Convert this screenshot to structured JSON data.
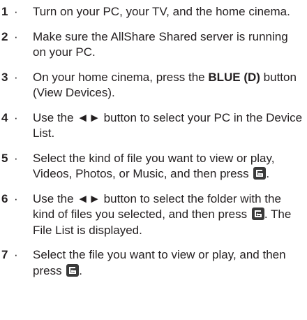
{
  "steps": [
    {
      "number": "1",
      "separator": "·",
      "text": "Turn on your PC, your TV, and the home cinema."
    },
    {
      "number": "2",
      "separator": "·",
      "text": "Make sure the AllShare Shared server is running on your PC."
    },
    {
      "number": "3",
      "separator": "·",
      "text_before": "On your home cinema, press the ",
      "bold": "BLUE (D)",
      "text_after": " button (View Devices)."
    },
    {
      "number": "4",
      "separator": "·",
      "text": "Use the ◄► button to select your PC in the Device List."
    },
    {
      "number": "5",
      "separator": "·",
      "text_before": "Select the kind of file you want to view or play, Videos, Photos, or Music, and then press ",
      "icon": "enter-button-icon",
      "text_after": "."
    },
    {
      "number": "6",
      "separator": "·",
      "text_before": "Use the ◄► button to select the folder with the kind of files you selected, and then press ",
      "icon": "enter-button-icon",
      "text_after": ". The File List is displayed."
    },
    {
      "number": "7",
      "separator": "·",
      "text_before": "Select the file you want to view or play, and then press ",
      "icon": "enter-button-icon",
      "text_after": "."
    }
  ]
}
